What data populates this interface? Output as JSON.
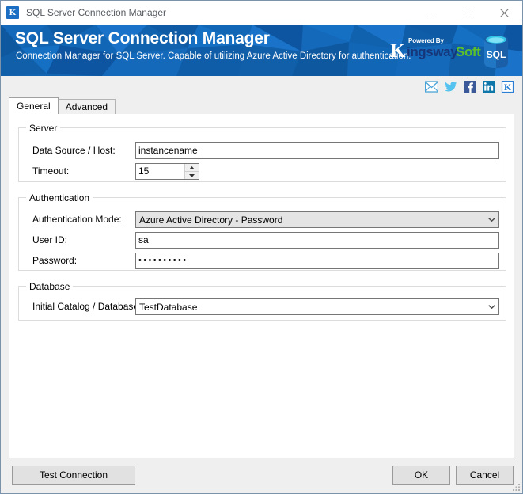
{
  "window": {
    "title": "SQL Server Connection Manager",
    "app_icon_letter": "K",
    "controls": {
      "minimize": "minimize-icon",
      "maximize": "maximize-icon",
      "close": "close-icon"
    }
  },
  "banner": {
    "title": "SQL Server Connection Manager",
    "subtitle": "Connection Manager for SQL Server. Capable of utilizing Azure Active Directory for authentication.",
    "brand": {
      "powered_by": "Powered By",
      "k_letter": "K",
      "name_part1": "ingsway",
      "name_part2": "Soft",
      "sql_icon_label": "SQL"
    },
    "colors": {
      "background": "#1263b0",
      "brand_dark": "#16367a",
      "brand_green": "#5cc02a",
      "sql_body": "#1b5fa8",
      "sql_top": "#32c5e8"
    }
  },
  "social_links": [
    {
      "name": "email-icon",
      "label": "Email"
    },
    {
      "name": "twitter-icon",
      "label": "Twitter"
    },
    {
      "name": "facebook-icon",
      "label": "Facebook"
    },
    {
      "name": "linkedin-icon",
      "label": "LinkedIn"
    },
    {
      "name": "kingswaysoft-icon",
      "label": "KingswaySoft"
    }
  ],
  "tabs": [
    {
      "label": "General",
      "active": true
    },
    {
      "label": "Advanced",
      "active": false
    }
  ],
  "groups": {
    "server": {
      "title": "Server",
      "data_source_label": "Data Source / Host:",
      "data_source_value": "instancename",
      "data_source_placeholder": "",
      "timeout_label": "Timeout:",
      "timeout_value": "15"
    },
    "authentication": {
      "title": "Authentication",
      "mode_label": "Authentication Mode:",
      "mode_value": "Azure Active Directory - Password",
      "user_id_label": "User ID:",
      "user_id_value": "sa",
      "password_label": "Password:",
      "password_value": "••••••••••"
    },
    "database": {
      "title": "Database",
      "catalog_label": "Initial Catalog / Database:",
      "catalog_value": "TestDatabase"
    }
  },
  "footer": {
    "test_connection_label": "Test Connection",
    "ok_label": "OK",
    "cancel_label": "Cancel"
  }
}
